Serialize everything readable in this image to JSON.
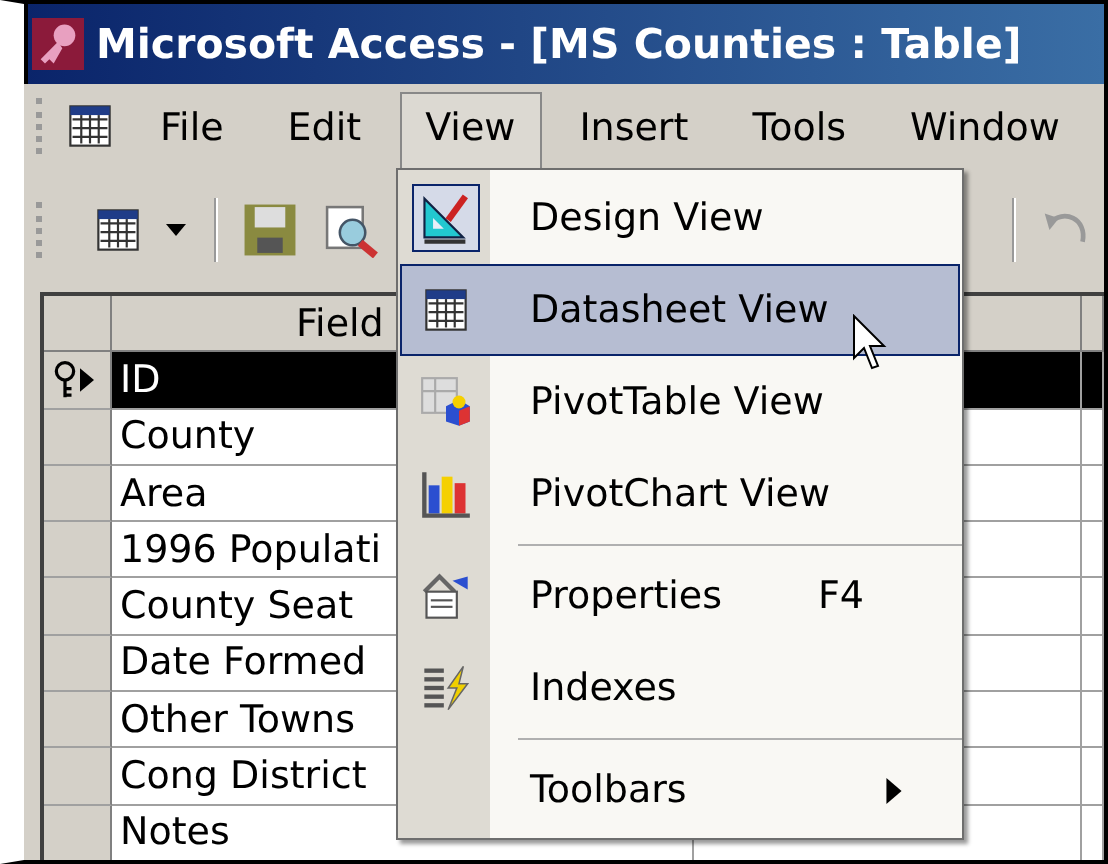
{
  "window": {
    "title": "Microsoft Access - [MS Counties : Table]"
  },
  "menu_bar": [
    {
      "label": "File",
      "selected": false
    },
    {
      "label": "Edit",
      "selected": false
    },
    {
      "label": "View",
      "selected": true
    },
    {
      "label": "Insert",
      "selected": false
    },
    {
      "label": "Tools",
      "selected": false
    },
    {
      "label": "Window",
      "selected": false
    }
  ],
  "table": {
    "columns": [
      "Field"
    ],
    "rows": [
      {
        "field": "ID",
        "primary_key": true,
        "current": true,
        "selected": true
      },
      {
        "field": "County",
        "primary_key": false,
        "current": false,
        "selected": false
      },
      {
        "field": "Area",
        "primary_key": false,
        "current": false,
        "selected": false
      },
      {
        "field": "1996 Populati",
        "primary_key": false,
        "current": false,
        "selected": false
      },
      {
        "field": "County Seat",
        "primary_key": false,
        "current": false,
        "selected": false
      },
      {
        "field": "Date Formed",
        "primary_key": false,
        "current": false,
        "selected": false
      },
      {
        "field": "Other Towns",
        "primary_key": false,
        "current": false,
        "selected": false
      },
      {
        "field": "Cong District",
        "primary_key": false,
        "current": false,
        "selected": false
      },
      {
        "field": "Notes",
        "primary_key": false,
        "current": false,
        "selected": false
      }
    ]
  },
  "view_menu": {
    "items": [
      {
        "kind": "item",
        "label": "Design View",
        "checked": true,
        "selected": false
      },
      {
        "kind": "item",
        "label": "Datasheet View",
        "checked": false,
        "selected": true
      },
      {
        "kind": "item",
        "label": "PivotTable View",
        "checked": false,
        "selected": false
      },
      {
        "kind": "item",
        "label": "PivotChart View",
        "checked": false,
        "selected": false
      },
      {
        "kind": "separator"
      },
      {
        "kind": "item",
        "label": "Properties",
        "shortcut": "F4",
        "checked": false,
        "selected": false
      },
      {
        "kind": "item",
        "label": "Indexes",
        "checked": false,
        "selected": false
      },
      {
        "kind": "separator"
      },
      {
        "kind": "submenu",
        "label": "Toolbars",
        "selected": false
      }
    ]
  }
}
